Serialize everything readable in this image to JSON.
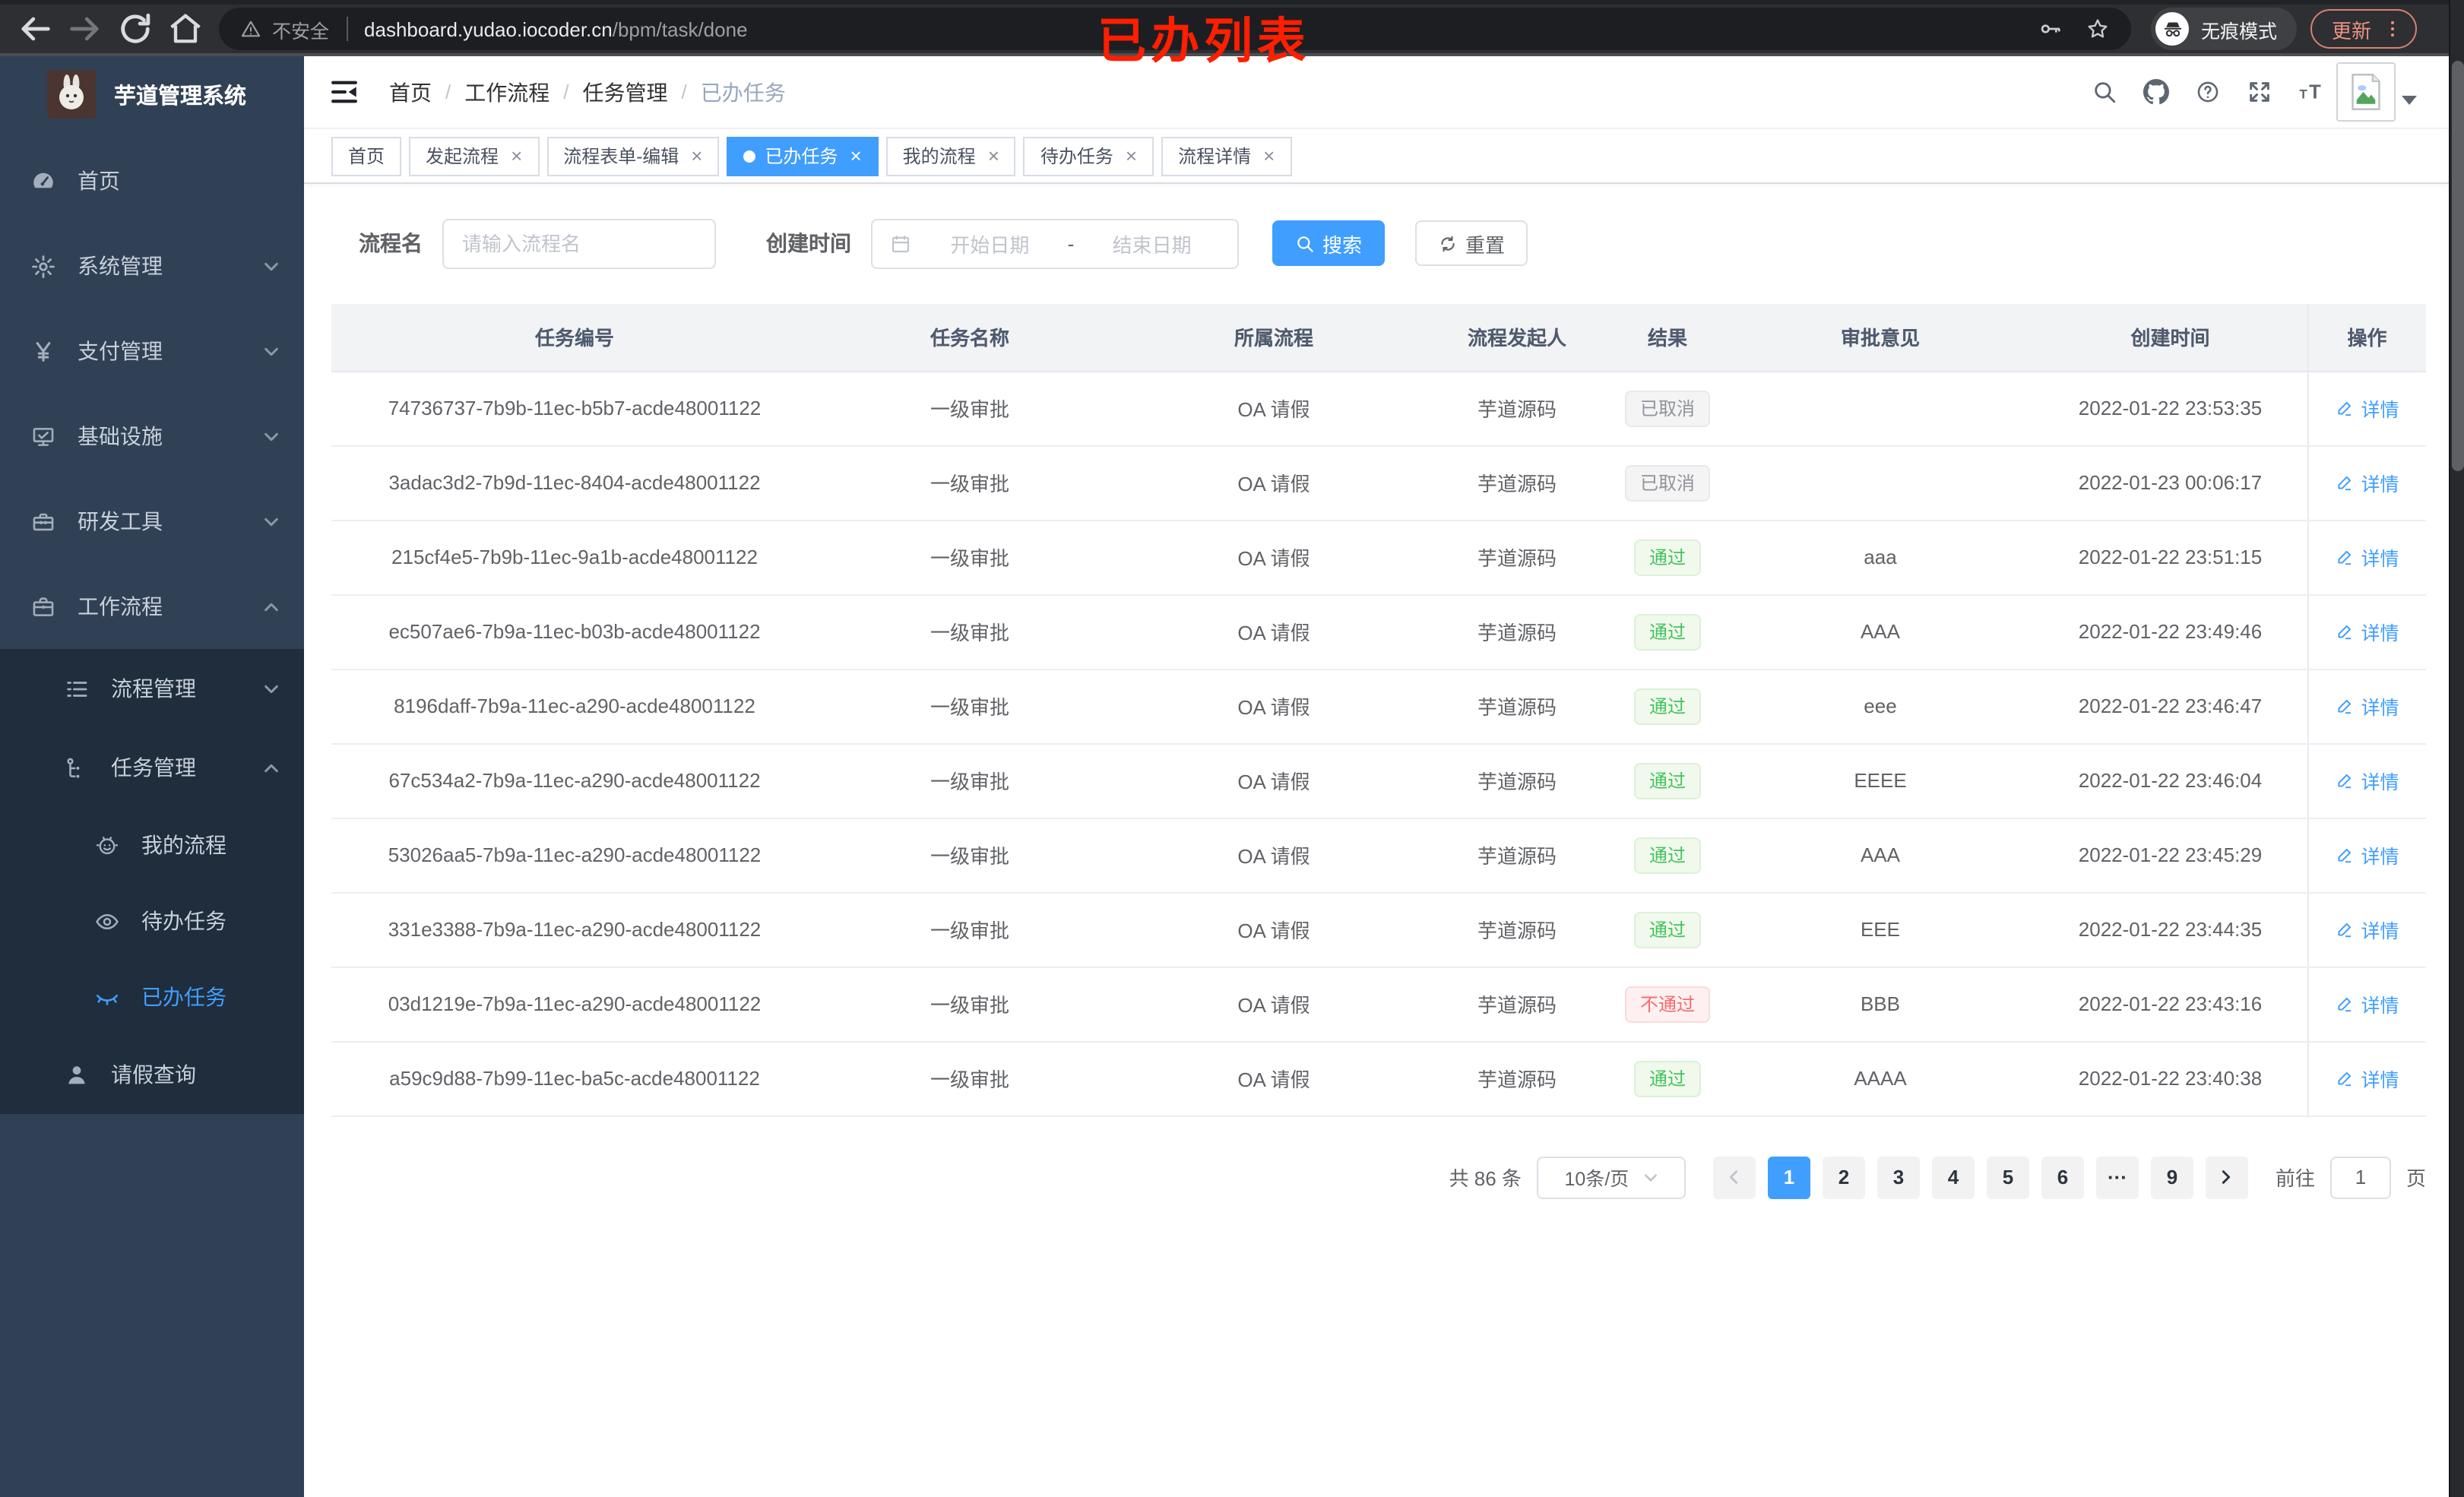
{
  "colors": {
    "accent": "#409eff",
    "success": "#43c35f",
    "danger": "#f56c6c",
    "info": "#909399",
    "annotation_red": "#fe1e00",
    "sidebar_bg": "#304156",
    "submenu_bg": "#1f2d3d"
  },
  "browser": {
    "security": "不安全",
    "url_host": "dashboard.yudao.iocoder.cn",
    "url_path": "/bpm/task/done",
    "incognito": "无痕模式",
    "update": "更新",
    "annotation": "已办列表",
    "nav_icons": [
      "back-icon",
      "forward-icon",
      "reload-icon",
      "home-icon"
    ]
  },
  "sidebar": {
    "title": "芋道管理系统",
    "menu": [
      {
        "label": "首页",
        "icon": "dashboard-icon",
        "level": 1
      },
      {
        "label": "系统管理",
        "icon": "gear-icon",
        "level": 1,
        "chevron": "down"
      },
      {
        "label": "支付管理",
        "icon": "yen-icon",
        "level": 1,
        "chevron": "down"
      },
      {
        "label": "基础设施",
        "icon": "monitor-icon",
        "level": 1,
        "chevron": "down"
      },
      {
        "label": "研发工具",
        "icon": "toolbox-icon",
        "level": 1,
        "chevron": "down"
      },
      {
        "label": "工作流程",
        "icon": "briefcase-icon",
        "level": 1,
        "chevron": "up"
      },
      {
        "label": "流程管理",
        "icon": "list-icon",
        "level": 2,
        "chevron": "down",
        "submenu": true
      },
      {
        "label": "任务管理",
        "icon": "tree-icon",
        "level": 2,
        "chevron": "up",
        "submenu": true
      },
      {
        "label": "我的流程",
        "icon": "robot-icon",
        "level": 3,
        "submenu": true
      },
      {
        "label": "待办任务",
        "icon": "eye-icon",
        "level": 3,
        "submenu": true
      },
      {
        "label": "已办任务",
        "icon": "eye-closed-icon",
        "level": 3,
        "submenu": true,
        "active": true
      },
      {
        "label": "请假查询",
        "icon": "user-icon",
        "level": 2,
        "submenu": true
      }
    ]
  },
  "breadcrumb": [
    "首页",
    "工作流程",
    "任务管理",
    "已办任务"
  ],
  "breadcrumb_sep": "/",
  "header": {
    "icons": [
      "search-icon",
      "github-icon",
      "question-icon",
      "fullscreen-icon",
      "font-size-icon"
    ]
  },
  "tabs": [
    {
      "label": "首页",
      "closable": false,
      "active": false
    },
    {
      "label": "发起流程",
      "closable": true,
      "active": false
    },
    {
      "label": "流程表单-编辑",
      "closable": true,
      "active": false
    },
    {
      "label": "已办任务",
      "closable": true,
      "active": true
    },
    {
      "label": "我的流程",
      "closable": true,
      "active": false
    },
    {
      "label": "待办任务",
      "closable": true,
      "active": false
    },
    {
      "label": "流程详情",
      "closable": true,
      "active": false
    }
  ],
  "filters": {
    "name_label": "流程名",
    "name_placeholder": "请输入流程名",
    "time_label": "创建时间",
    "start_placeholder": "开始日期",
    "range_separator": "-",
    "end_placeholder": "结束日期",
    "search": "搜索",
    "reset": "重置"
  },
  "table": {
    "columns": [
      "任务编号",
      "任务名称",
      "所属流程",
      "流程发起人",
      "结果",
      "审批意见",
      "创建时间",
      "操作"
    ],
    "detail_label": "详情",
    "rows": [
      {
        "id": "74736737-7b9b-11ec-b5b7-acde48001122",
        "name": "一级审批",
        "process": "OA 请假",
        "starter": "芋道源码",
        "result": "已取消",
        "result_type": "info",
        "comment": "",
        "created": "2022-01-22 23:53:35"
      },
      {
        "id": "3adac3d2-7b9d-11ec-8404-acde48001122",
        "name": "一级审批",
        "process": "OA 请假",
        "starter": "芋道源码",
        "result": "已取消",
        "result_type": "info",
        "comment": "",
        "created": "2022-01-23 00:06:17"
      },
      {
        "id": "215cf4e5-7b9b-11ec-9a1b-acde48001122",
        "name": "一级审批",
        "process": "OA 请假",
        "starter": "芋道源码",
        "result": "通过",
        "result_type": "success",
        "comment": "aaa",
        "created": "2022-01-22 23:51:15"
      },
      {
        "id": "ec507ae6-7b9a-11ec-b03b-acde48001122",
        "name": "一级审批",
        "process": "OA 请假",
        "starter": "芋道源码",
        "result": "通过",
        "result_type": "success",
        "comment": "AAA",
        "created": "2022-01-22 23:49:46"
      },
      {
        "id": "8196daff-7b9a-11ec-a290-acde48001122",
        "name": "一级审批",
        "process": "OA 请假",
        "starter": "芋道源码",
        "result": "通过",
        "result_type": "success",
        "comment": "eee",
        "created": "2022-01-22 23:46:47"
      },
      {
        "id": "67c534a2-7b9a-11ec-a290-acde48001122",
        "name": "一级审批",
        "process": "OA 请假",
        "starter": "芋道源码",
        "result": "通过",
        "result_type": "success",
        "comment": "EEEE",
        "created": "2022-01-22 23:46:04"
      },
      {
        "id": "53026aa5-7b9a-11ec-a290-acde48001122",
        "name": "一级审批",
        "process": "OA 请假",
        "starter": "芋道源码",
        "result": "通过",
        "result_type": "success",
        "comment": "AAA",
        "created": "2022-01-22 23:45:29"
      },
      {
        "id": "331e3388-7b9a-11ec-a290-acde48001122",
        "name": "一级审批",
        "process": "OA 请假",
        "starter": "芋道源码",
        "result": "通过",
        "result_type": "success",
        "comment": "EEE",
        "created": "2022-01-22 23:44:35"
      },
      {
        "id": "03d1219e-7b9a-11ec-a290-acde48001122",
        "name": "一级审批",
        "process": "OA 请假",
        "starter": "芋道源码",
        "result": "不通过",
        "result_type": "danger",
        "comment": "BBB",
        "created": "2022-01-22 23:43:16"
      },
      {
        "id": "a59c9d88-7b99-11ec-ba5c-acde48001122",
        "name": "一级审批",
        "process": "OA 请假",
        "starter": "芋道源码",
        "result": "通过",
        "result_type": "success",
        "comment": "AAAA",
        "created": "2022-01-22 23:40:38"
      }
    ]
  },
  "pagination": {
    "total": "共 86 条",
    "page_size": "10条/页",
    "pages": [
      "1",
      "2",
      "3",
      "4",
      "5",
      "6",
      "···",
      "9"
    ],
    "active_page": "1",
    "goto_label": "前往",
    "goto_value": "1",
    "page_label": "页"
  }
}
